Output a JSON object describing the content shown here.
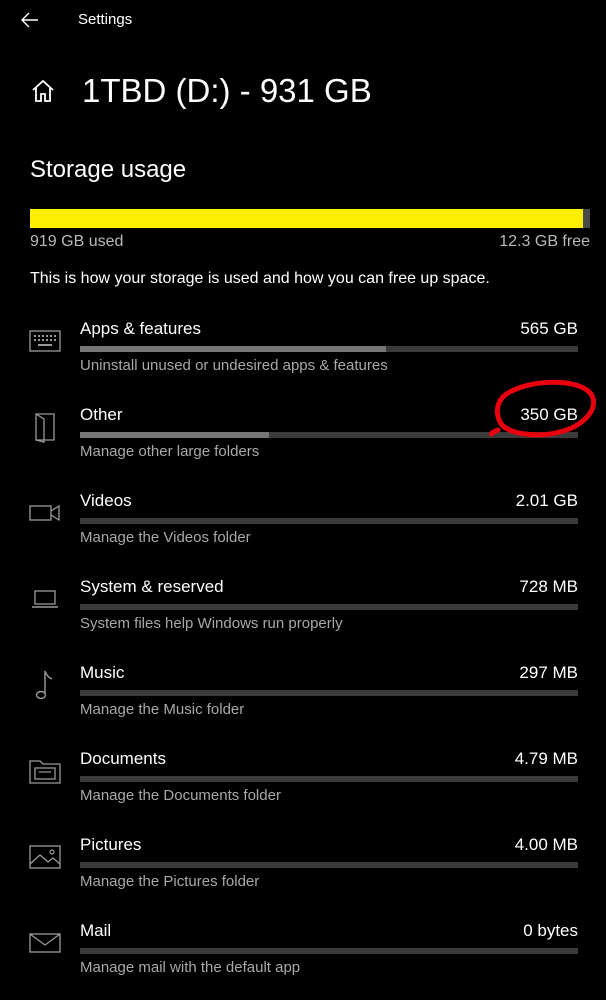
{
  "titlebar": {
    "back_icon": "back-arrow-icon",
    "app_title": "Settings"
  },
  "header": {
    "home_icon": "home-icon",
    "title": "1TBD (D:) - 931 GB"
  },
  "storage": {
    "section_title": "Storage usage",
    "used_label": "919 GB used",
    "free_label": "12.3 GB free",
    "used_fraction": 0.987,
    "bar_color": "#ffef00",
    "description": "This is how your storage is used and how you can free up space."
  },
  "categories": [
    {
      "name": "Apps & features",
      "size": "565 GB",
      "desc": "Uninstall unused or undesired apps & features",
      "icon": "keyboard-icon",
      "fraction": 0.615
    },
    {
      "name": "Other",
      "size": "350 GB",
      "desc": "Manage other large folders",
      "icon": "other-folder-icon",
      "fraction": 0.38
    },
    {
      "name": "Videos",
      "size": "2.01 GB",
      "desc": "Manage the Videos folder",
      "icon": "video-camera-icon",
      "fraction": 0
    },
    {
      "name": "System & reserved",
      "size": "728 MB",
      "desc": "System files help Windows run properly",
      "icon": "laptop-icon",
      "fraction": 0
    },
    {
      "name": "Music",
      "size": "297 MB",
      "desc": "Manage the Music folder",
      "icon": "music-note-icon",
      "fraction": 0
    },
    {
      "name": "Documents",
      "size": "4.79 MB",
      "desc": "Manage the Documents folder",
      "icon": "documents-folder-icon",
      "fraction": 0
    },
    {
      "name": "Pictures",
      "size": "4.00 MB",
      "desc": "Manage the Pictures folder",
      "icon": "picture-icon",
      "fraction": 0
    },
    {
      "name": "Mail",
      "size": "0 bytes",
      "desc": "Manage mail with the default app",
      "icon": "mail-icon",
      "fraction": 0
    }
  ],
  "annotation": {
    "type": "hand-drawn-circle",
    "color": "#e8000e",
    "target": "Other"
  }
}
